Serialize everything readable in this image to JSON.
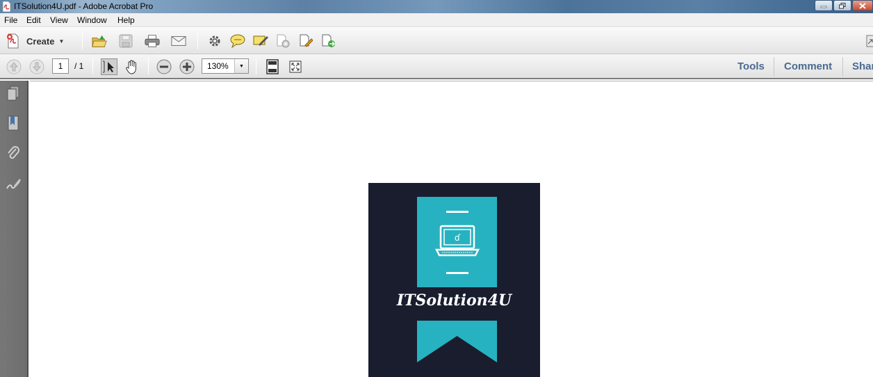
{
  "window": {
    "title": "ITSolution4U.pdf - Adobe Acrobat Pro"
  },
  "menu": {
    "items": [
      "File",
      "Edit",
      "View",
      "Window",
      "Help"
    ]
  },
  "toolbar": {
    "create_label": "Create"
  },
  "nav": {
    "page_current": "1",
    "page_total": "/ 1",
    "zoom": "130%"
  },
  "panes": {
    "tools": "Tools",
    "comment": "Comment",
    "share": "Shar"
  },
  "document": {
    "logo_text": "ITSolution4U"
  },
  "colors": {
    "accent_teal": "#27b2c1",
    "logo_bg": "#1a1d2e",
    "pane_link": "#4a6a91"
  }
}
